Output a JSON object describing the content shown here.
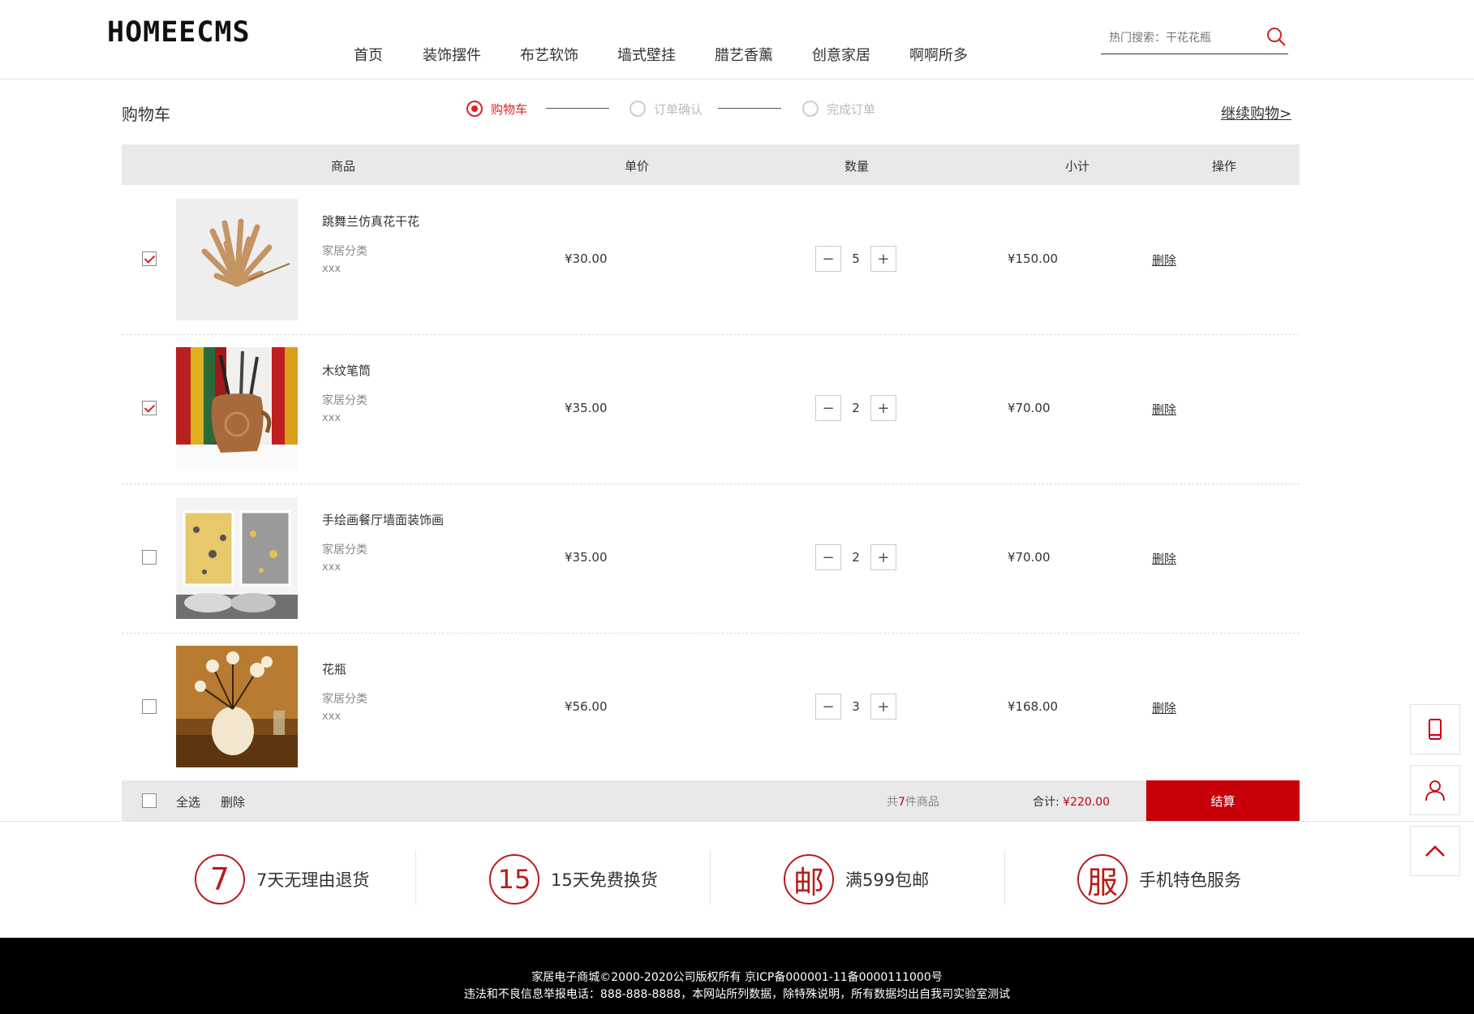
{
  "header": {
    "logo": "HOMEECMS",
    "nav": [
      "首页",
      "装饰摆件",
      "布艺软饰",
      "墙式壁挂",
      "腊艺香薰",
      "创意家居",
      "啊啊所多"
    ],
    "search_placeholder": "热门搜索：干花花瓶"
  },
  "cart": {
    "title": "购物车",
    "steps": [
      "购物车",
      "订单确认",
      "完成订单"
    ],
    "continue": "继续购物>",
    "columns": [
      "商品",
      "单价",
      "数量",
      "小计",
      "操作"
    ],
    "items": [
      {
        "name": "跳舞兰仿真花干花",
        "category": "家居分类",
        "spec": "xxx",
        "price": "¥30.00",
        "qty": "5",
        "subtotal": "¥150.00",
        "delete": "删除",
        "checked": true
      },
      {
        "name": "木纹笔筒",
        "category": "家居分类",
        "spec": "xxx",
        "price": "¥35.00",
        "qty": "2",
        "subtotal": "¥70.00",
        "delete": "删除",
        "checked": true
      },
      {
        "name": "手绘画餐厅墙面装饰画",
        "category": "家居分类",
        "spec": "xxx",
        "price": "¥35.00",
        "qty": "2",
        "subtotal": "¥70.00",
        "delete": "删除",
        "checked": false
      },
      {
        "name": "花瓶",
        "category": "家居分类",
        "spec": "xxx",
        "price": "¥56.00",
        "qty": "3",
        "subtotal": "¥168.00",
        "delete": "删除",
        "checked": false
      }
    ],
    "minus": "−",
    "plus": "+",
    "footer": {
      "select_all": "全选",
      "delete": "删除",
      "count_prefix": "共",
      "count": "7",
      "count_suffix": "件商品",
      "total_label": "合计:",
      "total": "¥220.00",
      "checkout": "结算"
    }
  },
  "services": [
    {
      "icon": "7",
      "label": "7天无理由退货"
    },
    {
      "icon": "15",
      "label": "15天免费换货"
    },
    {
      "icon": "邮",
      "label": "满599包邮"
    },
    {
      "icon": "服",
      "label": "手机特色服务"
    }
  ],
  "footer": {
    "line1": "家居电子商城©2000-2020公司版权所有 京ICP备000001-11备0000111000号",
    "line2": "违法和不良信息举报电话：888-888-8888，本网站所列数据，除特殊说明，所有数据均出自我司实验室测试"
  },
  "colors": {
    "accent": "#c8000a",
    "accent_light": "#e02020",
    "footer_bg": "#000000"
  }
}
